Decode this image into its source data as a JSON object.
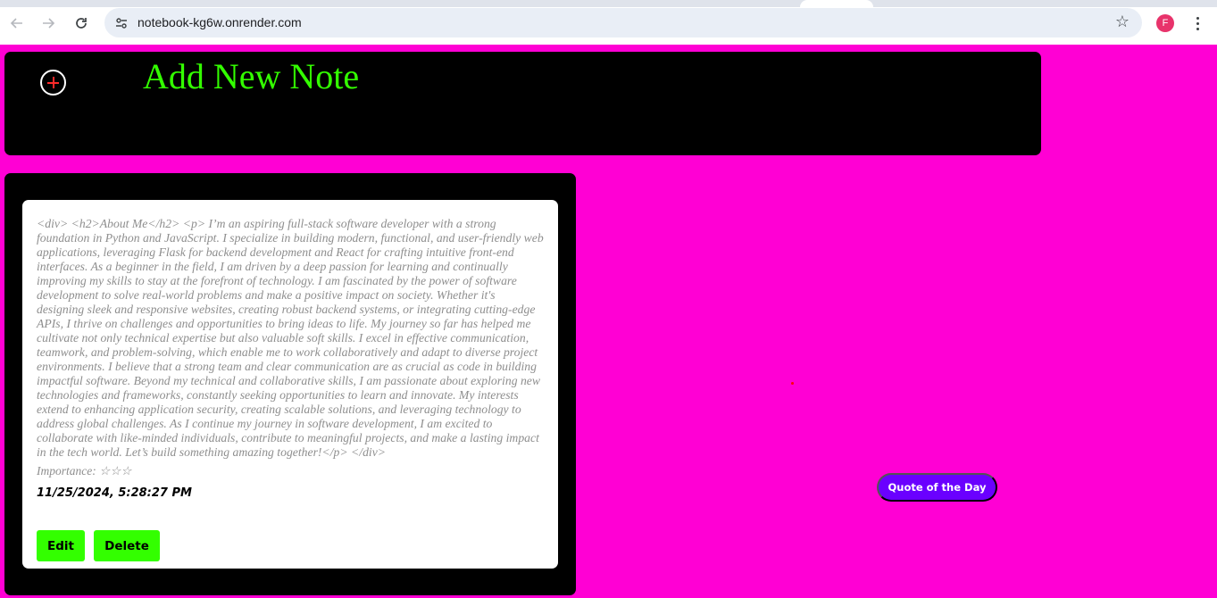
{
  "browser": {
    "url": "notebook-kg6w.onrender.com",
    "profile_initial": "F",
    "icons": {
      "back": "arrow-left-icon",
      "forward": "arrow-right-icon",
      "reload": "reload-icon",
      "site_info": "tune-icon",
      "bookmark": "star-icon",
      "menu": "kebab-menu-icon"
    }
  },
  "header": {
    "add_icon": "plus-circle-icon",
    "title": "Add New Note"
  },
  "notes": [
    {
      "body": "<div> <h2>About Me</h2> <p> I’m an aspiring full-stack software developer with a strong foundation in Python and JavaScript. I specialize in building modern, functional, and user-friendly web applications, leveraging Flask for backend development and React for crafting intuitive front-end interfaces. As a beginner in the field, I am driven by a deep passion for learning and continually improving my skills to stay at the forefront of technology. I am fascinated by the power of software development to solve real-world problems and make a positive impact on society. Whether it's designing sleek and responsive websites, creating robust backend systems, or integrating cutting-edge APIs, I thrive on challenges and opportunities to bring ideas to life. My journey so far has helped me cultivate not only technical expertise but also valuable soft skills. I excel in effective communication, teamwork, and problem-solving, which enable me to work collaboratively and adapt to diverse project environments. I believe that a strong team and clear communication are as crucial as code in building impactful software. Beyond my technical and collaborative skills, I am passionate about exploring new technologies and frameworks, constantly seeking opportunities to learn and innovate. My interests extend to enhancing application security, creating scalable solutions, and leveraging technology to address global challenges. As I continue my journey in software development, I am excited to collaborate with like-minded individuals, contribute to meaningful projects, and make a lasting impact in the tech world. Let’s build something amazing together!</p> </div>",
      "importance": "Importance: ☆☆☆",
      "timestamp": "11/25/2024, 5:28:27 PM",
      "edit_label": "Edit",
      "delete_label": "Delete"
    }
  ],
  "quote_button_label": "Quote of the Day",
  "colors": {
    "page_background": "#ff00d4",
    "panel_background": "#000000",
    "accent_green": "#33ff00",
    "quote_button": "#6a00ff",
    "plus_sign": "#ff2a2a"
  }
}
